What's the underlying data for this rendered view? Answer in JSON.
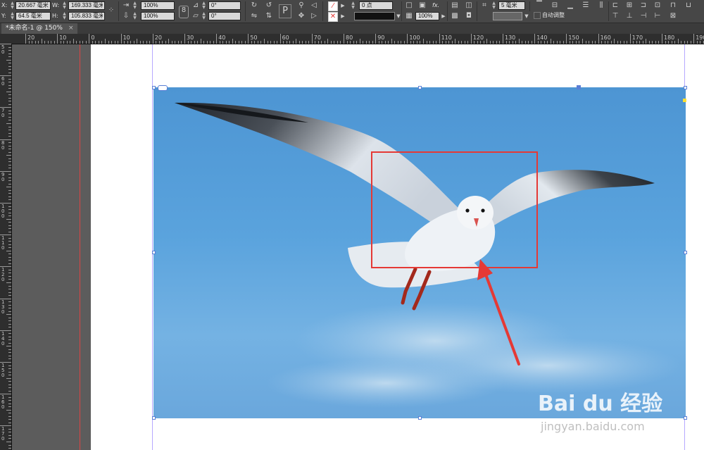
{
  "control_bar": {
    "x_label": "X:",
    "y_label": "Y:",
    "x_value": "20.667 毫米",
    "y_value": "64.5 毫米",
    "w_label": "W:",
    "h_label": "H:",
    "w_value": "169.333 毫米",
    "h_value": "105.833 毫米",
    "scale_x": "100%",
    "scale_y": "100%",
    "rotate": "0°",
    "shear": "0°",
    "stroke_weight": "0 点",
    "opacity": "100%",
    "gap_value": "5 毫米",
    "auto_fit_label": "自动调整",
    "p_icon_label": "P",
    "fx_label": "fx."
  },
  "tab": {
    "title": "*未命名-1 @ 150%",
    "close_label": "×"
  },
  "h_ruler_labels": [
    "20",
    "10",
    "0",
    "10",
    "20",
    "30",
    "40",
    "50",
    "60",
    "70",
    "80",
    "90",
    "100",
    "110",
    "120",
    "130",
    "140",
    "150",
    "160",
    "170",
    "180",
    "190"
  ],
  "v_ruler_labels": [
    "5\n0",
    "6\n0",
    "7\n0",
    "8\n0",
    "9\n0",
    "1\n0\n0",
    "1\n1\n0",
    "1\n2\n0",
    "1\n3\n0",
    "1\n4\n0",
    "1\n5\n0",
    "1\n6\n0",
    "1\n7\n0"
  ],
  "watermark": {
    "logo_text": "Bai du 经验",
    "url": "jingyan.baidu.com"
  },
  "colors": {
    "annotation_red": "#e53935",
    "sky_blue": "#5aa3dd",
    "frame_blue": "#5a7fd6"
  }
}
